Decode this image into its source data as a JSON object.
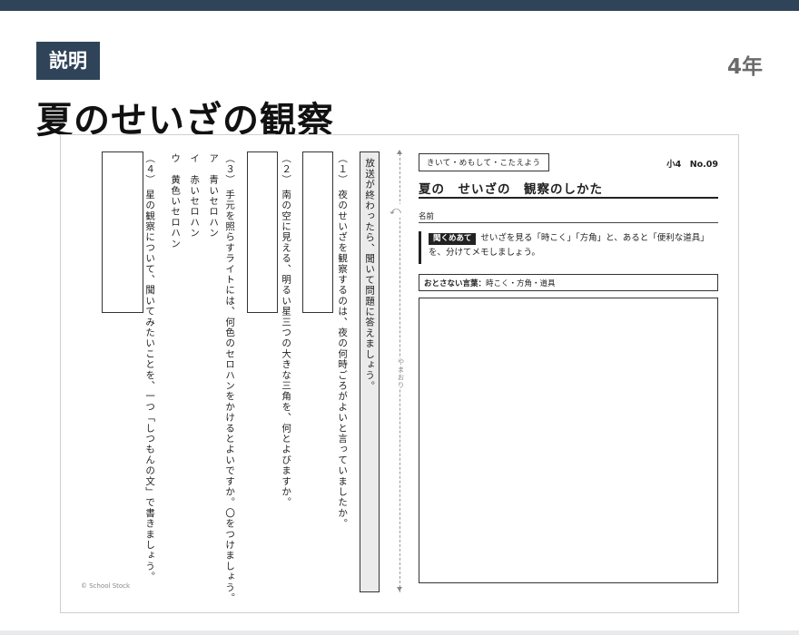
{
  "header": {
    "badge": "説明",
    "grade": "4年",
    "title": "夏のせいざの観察"
  },
  "worksheet": {
    "instruction": "放送が終わったら、聞いて問題に答えましょう。",
    "questions": [
      {
        "lines": [
          "（１） 夜のせいざを観察するのは、夜の何時ごろがよいと言っていましたか。"
        ]
      },
      {
        "lines": [
          "（２） 南の空に見える、明るい星三つの大きな三角を、何とよびますか。"
        ]
      },
      {
        "lines": [
          "（３） 手元を照らすライトには、何色のセロハンをかけるとよいですか。〇をつけましょう。",
          "ア　青いセロハン",
          "イ　赤いセロハン",
          "ウ　黄色いセロハン"
        ]
      },
      {
        "lines": [
          "（４） 星の観察について、聞いてみたいことを、一つ「しつもんの文」で書きましょう。"
        ]
      }
    ],
    "fold_label": "やまおり",
    "copyright": "© School Stock",
    "right": {
      "tag": "きいて・めもして・こたえよう",
      "code": "小4　No.09",
      "title": "夏の　せいざの　観察のしかた",
      "name_label": "名前",
      "listen_tag": "聞くめあて",
      "listen_text": "せいざを見る「時こく」「方角」と、あると「便利な道具」を、分けてメモしましょう。",
      "words_label": "おとさない言葉：",
      "words_value": "時こく・方角・道具"
    }
  }
}
